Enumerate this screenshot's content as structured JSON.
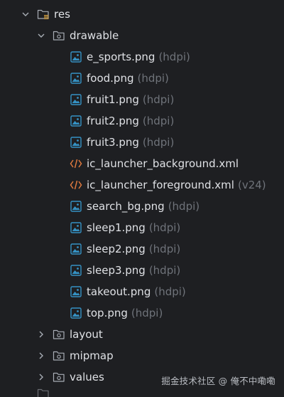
{
  "tree": {
    "root": {
      "label": "res",
      "expanded": true,
      "icon": "resource-folder-icon"
    },
    "drawable": {
      "label": "drawable",
      "expanded": true,
      "icon": "folder-icon",
      "files": [
        {
          "name": "e_sports.png",
          "qualifier": "(hdpi)",
          "icon": "image-file-icon"
        },
        {
          "name": "food.png",
          "qualifier": "(hdpi)",
          "icon": "image-file-icon"
        },
        {
          "name": "fruit1.png",
          "qualifier": "(hdpi)",
          "icon": "image-file-icon"
        },
        {
          "name": "fruit2.png",
          "qualifier": "(hdpi)",
          "icon": "image-file-icon"
        },
        {
          "name": "fruit3.png",
          "qualifier": "(hdpi)",
          "icon": "image-file-icon"
        },
        {
          "name": "ic_launcher_background.xml",
          "qualifier": "",
          "icon": "xml-file-icon"
        },
        {
          "name": "ic_launcher_foreground.xml",
          "qualifier": "(v24)",
          "icon": "xml-file-icon"
        },
        {
          "name": "search_bg.png",
          "qualifier": "(hdpi)",
          "icon": "image-file-icon"
        },
        {
          "name": "sleep1.png",
          "qualifier": "(hdpi)",
          "icon": "image-file-icon"
        },
        {
          "name": "sleep2.png",
          "qualifier": "(hdpi)",
          "icon": "image-file-icon"
        },
        {
          "name": "sleep3.png",
          "qualifier": "(hdpi)",
          "icon": "image-file-icon"
        },
        {
          "name": "takeout.png",
          "qualifier": "(hdpi)",
          "icon": "image-file-icon"
        },
        {
          "name": "top.png",
          "qualifier": "(hdpi)",
          "icon": "image-file-icon"
        }
      ]
    },
    "collapsed_folders": [
      {
        "label": "layout",
        "expanded": false,
        "icon": "folder-icon"
      },
      {
        "label": "mipmap",
        "expanded": false,
        "icon": "folder-icon"
      },
      {
        "label": "values",
        "expanded": false,
        "icon": "folder-icon"
      }
    ]
  },
  "watermark": {
    "text": "掘金技术社区 @ 俺不中嘞嘞"
  },
  "colors": {
    "background": "#1e1f22",
    "text": "#dfe1e5",
    "hint": "#6f737a",
    "image_icon": "#3592c4",
    "xml_icon": "#e07a3f",
    "folder_icon": "#a8adb5"
  }
}
